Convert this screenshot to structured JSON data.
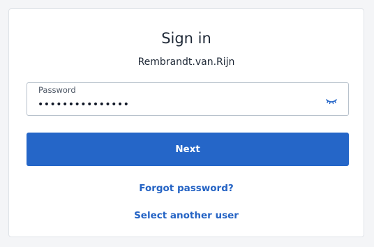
{
  "signin": {
    "title": "Sign in",
    "username": "Rembrandt.van.Rijn",
    "password_label": "Password",
    "password_value": "•••••••••••••••",
    "eye_icon": "eye-closed-icon",
    "next_label": "Next",
    "forgot_link": "Forgot password?",
    "switch_user_link": "Select another user"
  },
  "colors": {
    "primary": "#2566c8",
    "link": "#2463c4",
    "border": "#b8c2cc"
  }
}
